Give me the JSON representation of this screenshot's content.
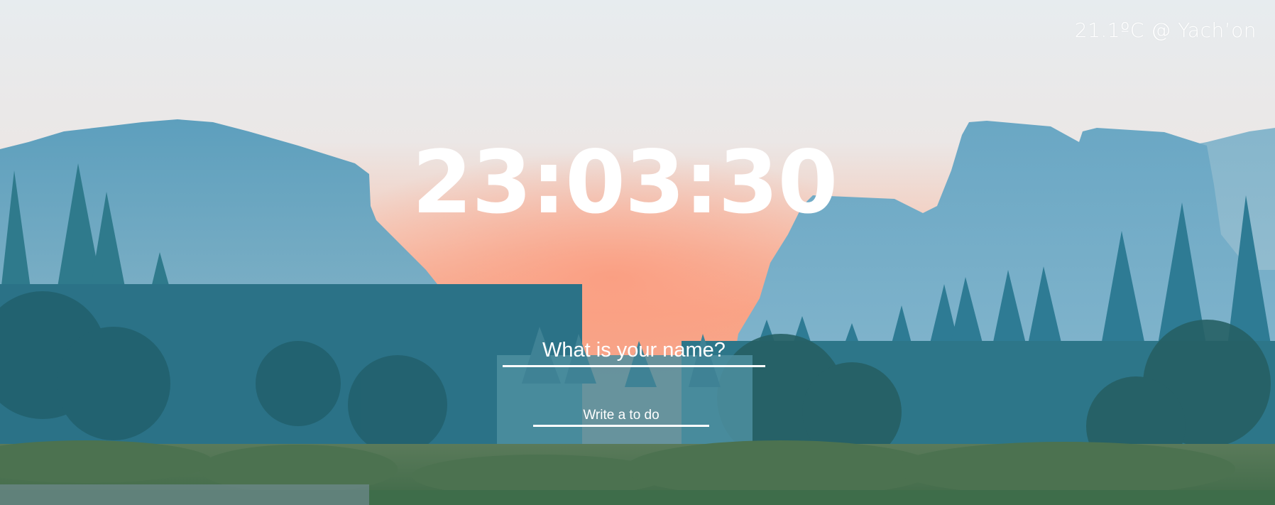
{
  "weather": {
    "text": "21.1ºC @ Yach’on"
  },
  "clock": {
    "time": "23:03:30"
  },
  "greeting_form": {
    "placeholder": "What is your name?"
  },
  "todo_form": {
    "placeholder": "Write a to do"
  },
  "background": {
    "description_icon": "mountain-valley-landscape-image",
    "sky_top_color": "#e9ecee",
    "sky_glow_color": "#f7a98e",
    "mountain_color": "#6fa9c4",
    "forest_color": "#2f7c93",
    "grass_color": "#4f7a52"
  }
}
